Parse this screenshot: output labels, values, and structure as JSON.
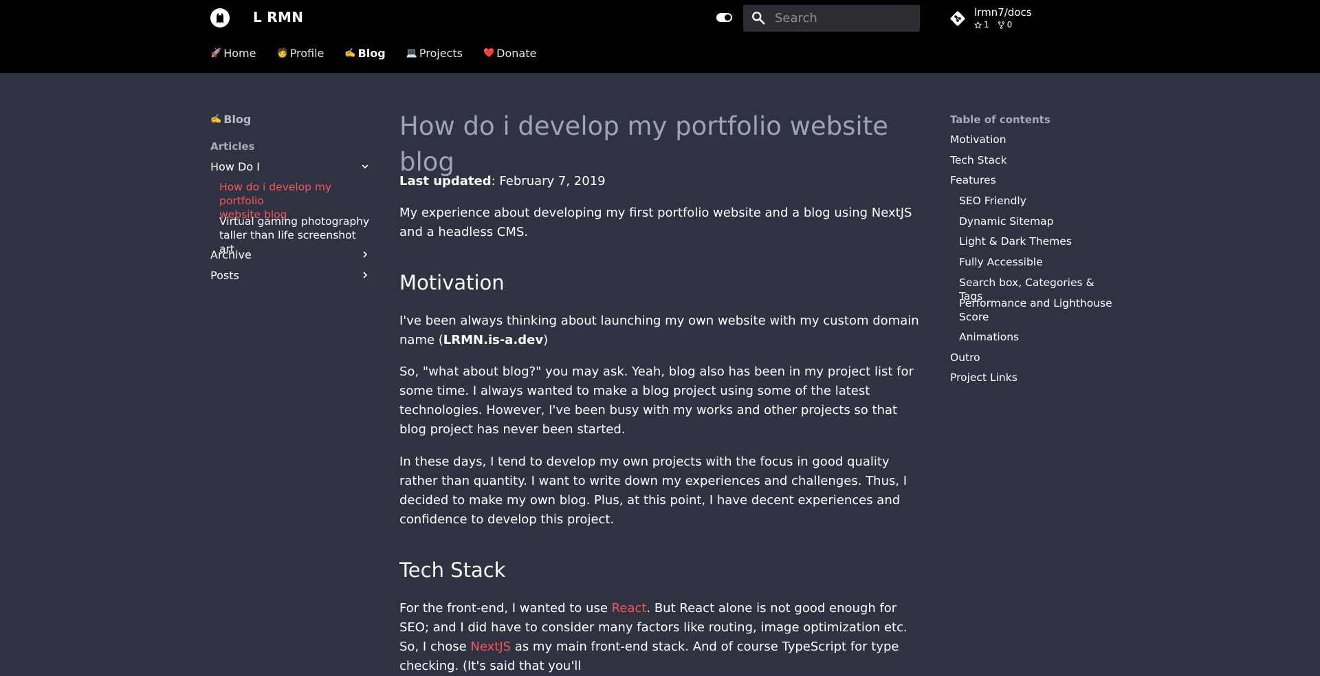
{
  "header": {
    "site_title": "L RMN",
    "search_placeholder": "Search",
    "repo": {
      "name": "lrmn7/docs",
      "stars": "1",
      "forks": "0"
    },
    "nav": [
      {
        "emoji": "🚀",
        "label": "Home"
      },
      {
        "emoji": "🧑",
        "label": "Profile"
      },
      {
        "emoji": "✍️",
        "label": "Blog"
      },
      {
        "emoji": "💻",
        "label": "Projects"
      },
      {
        "emoji": "❤️",
        "label": "Donate"
      }
    ]
  },
  "sidebar": {
    "blog_emoji": "✍️",
    "blog_label": "Blog",
    "articles_label": "Articles",
    "sections": [
      {
        "label": "How Do I"
      },
      {
        "label": "Archive"
      },
      {
        "label": "Posts"
      }
    ],
    "how_do_i_items": [
      {
        "line1": "How do i develop my portfolio",
        "line2": "website blog"
      },
      {
        "line1": "Virtual gaming photography",
        "line2": "taller than life screenshot art"
      }
    ]
  },
  "article": {
    "title": "How do i develop my portfolio website blog",
    "last_updated_label": "Last updated",
    "last_updated_value": ": February 7, 2019",
    "intro": "My experience about developing my first portfolio website and a blog using NextJS and a headless CMS.",
    "motivation_heading": "Motivation",
    "p1_text": "I've been always thinking about launching my own website with my custom domain name (",
    "p1_bold": "LRMN.is-a.dev",
    "p1_end": ")",
    "p2": "So, \"what about blog?\" you may ask. Yeah, blog also has been in my project list for some time. I always wanted to make a blog project using some of the latest technologies. However, I've been busy with my works and other projects so that blog project has never been started.",
    "p3": "In these days, I tend to develop my own projects with the focus in good quality rather than quantity. I want to write down my experiences and challenges. Thus, I decided to make my own blog. Plus, at this point, I have decent experiences and confidence to develop this project.",
    "tech_heading": "Tech Stack",
    "p4_a": "For the front-end, I wanted to use ",
    "p4_link1": "React",
    "p4_b": ". But React alone is not good enough for SEO; and I did have to consider many factors like routing, image optimization etc. So, I chose ",
    "p4_link2": "NextJS",
    "p4_c": " as my main front-end stack. And of course TypeScript for type checking. (It's said that you'll"
  },
  "toc": {
    "title": "Table of contents",
    "items": [
      {
        "label": "Motivation"
      },
      {
        "label": "Tech Stack"
      },
      {
        "label": "Features"
      },
      {
        "label": "SEO Friendly"
      },
      {
        "label": "Dynamic Sitemap"
      },
      {
        "label": "Light & Dark Themes"
      },
      {
        "label": "Fully Accessible"
      },
      {
        "label": "Search box, Categories & Tags"
      },
      {
        "label": "Performance and Lighthouse Score"
      },
      {
        "label": "Animations"
      },
      {
        "label": "Outro"
      },
      {
        "label": "Project Links"
      }
    ]
  }
}
